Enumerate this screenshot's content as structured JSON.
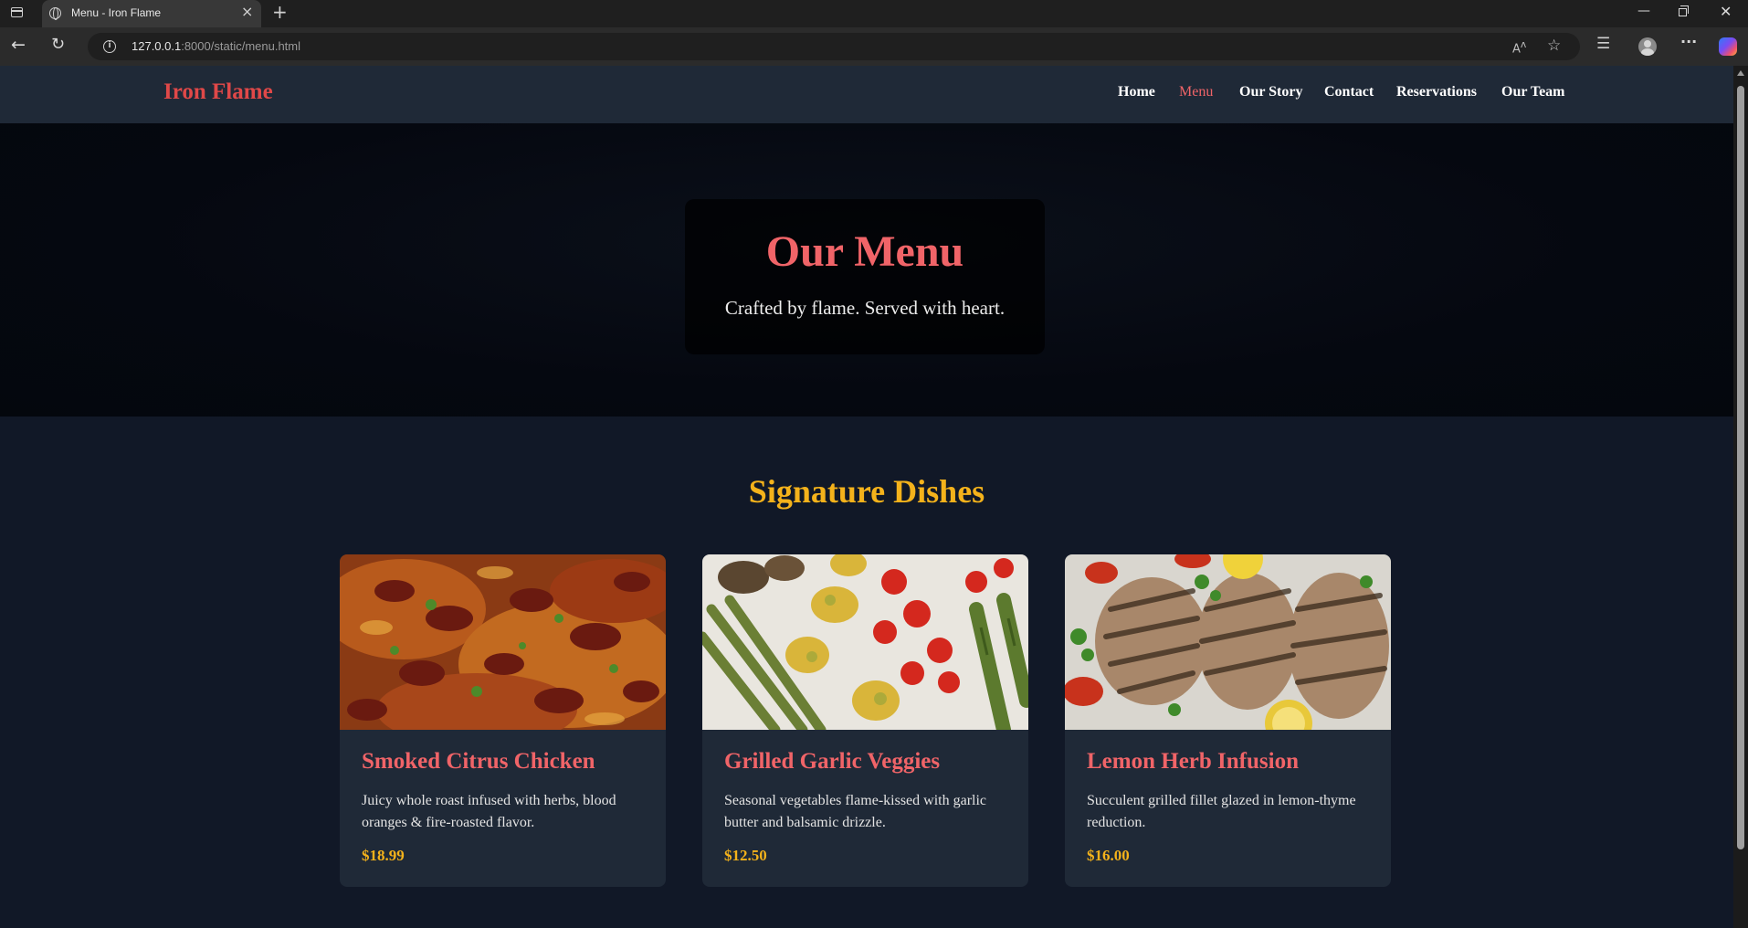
{
  "browser": {
    "tab_title": "Menu - Iron Flame",
    "url_host": "127.0.0.1",
    "url_rest": ":8000/static/menu.html"
  },
  "site": {
    "brand": "Iron Flame",
    "nav": [
      {
        "label": "Home",
        "active": false
      },
      {
        "label": "Menu",
        "active": true
      },
      {
        "label": "Our Story",
        "active": false
      },
      {
        "label": "Contact",
        "active": false
      },
      {
        "label": "Reservations",
        "active": false
      },
      {
        "label": "Our Team",
        "active": false
      }
    ]
  },
  "hero": {
    "title": "Our Menu",
    "subtitle": "Crafted by flame. Served with heart."
  },
  "section": {
    "title": "Signature Dishes"
  },
  "dishes": [
    {
      "name": "Smoked Citrus Chicken",
      "description": "Juicy whole roast infused with herbs, blood oranges & fire-roasted flavor.",
      "price": "$18.99"
    },
    {
      "name": "Grilled Garlic Veggies",
      "description": "Seasonal vegetables flame-kissed with garlic butter and balsamic drizzle.",
      "price": "$12.50"
    },
    {
      "name": "Lemon Herb Infusion",
      "description": "Succulent grilled fillet glazed in lemon-thyme reduction.",
      "price": "$16.00"
    }
  ],
  "colors": {
    "brand_red": "#e04848",
    "accent_coral": "#f06468",
    "gold": "#f4b21b",
    "header_bg": "#1f2937",
    "page_bg": "#111827"
  }
}
